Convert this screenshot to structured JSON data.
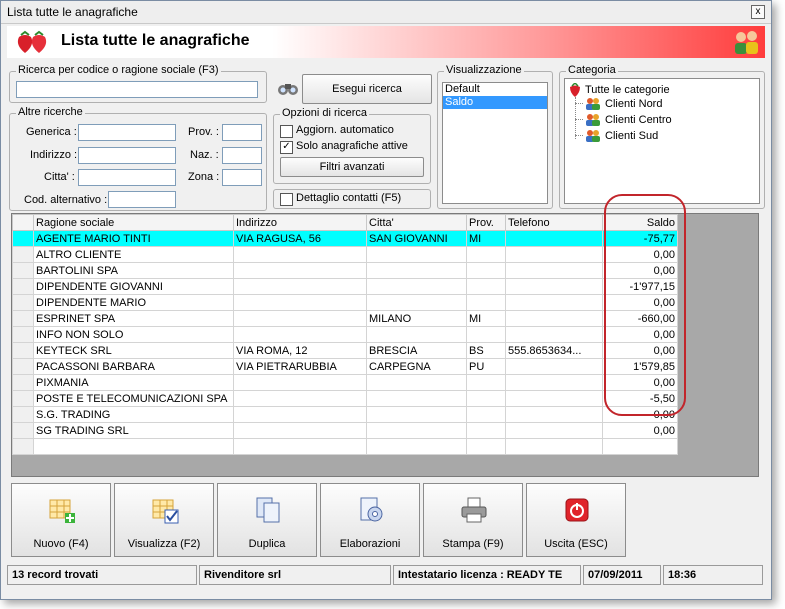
{
  "window": {
    "title": "Lista tutte le anagrafiche",
    "close_label": "x"
  },
  "banner": {
    "title": "Lista tutte le anagrafiche"
  },
  "search": {
    "legend": "Ricerca per codice o ragione sociale (F3)",
    "value": "",
    "run_label": "Esegui ricerca"
  },
  "other": {
    "legend": "Altre ricerche",
    "generica": "Generica :",
    "indirizzo": "Indirizzo :",
    "citta": "Citta' :",
    "cod_alt": "Cod. alternativo :",
    "prov": "Prov. :",
    "naz": "Naz. :",
    "zona": "Zona :"
  },
  "options": {
    "legend": "Opzioni di ricerca",
    "auto_label": "Aggiorn. automatico",
    "auto_checked": false,
    "active_label": "Solo anagrafiche attive",
    "active_checked": true,
    "mark": "✓",
    "advanced_label": "Filtri avanzati"
  },
  "details": {
    "label": "Dettaglio contatti (F5)",
    "checked": false
  },
  "visual": {
    "legend": "Visualizzazione",
    "items": [
      "Default",
      "Saldo"
    ],
    "selected": 1
  },
  "category": {
    "legend": "Categoria",
    "root": "Tutte le categorie",
    "items": [
      "Clienti Nord",
      "Clienti Centro",
      "Clienti Sud"
    ]
  },
  "table": {
    "headers": [
      "Ragione sociale",
      "Indirizzo",
      "Citta'",
      "Prov.",
      "Telefono",
      "Saldo"
    ],
    "rows": [
      [
        "AGENTE MARIO TINTI",
        "VIA RAGUSA, 56",
        "SAN GIOVANNI",
        "MI",
        "",
        "-75,77"
      ],
      [
        "ALTRO CLIENTE",
        "",
        "",
        "",
        "",
        "0,00"
      ],
      [
        "BARTOLINI SPA",
        "",
        "",
        "",
        "",
        "0,00"
      ],
      [
        "DIPENDENTE GIOVANNI",
        "",
        "",
        "",
        "",
        "-1'977,15"
      ],
      [
        "DIPENDENTE MARIO",
        "",
        "",
        "",
        "",
        "0,00"
      ],
      [
        "ESPRINET SPA",
        "",
        "MILANO",
        "MI",
        "",
        "-660,00"
      ],
      [
        "INFO NON SOLO",
        "",
        "",
        "",
        "",
        "0,00"
      ],
      [
        "KEYTECK SRL",
        "VIA ROMA, 12",
        "BRESCIA",
        "BS",
        "555.8653634...",
        "0,00"
      ],
      [
        "PACASSONI BARBARA",
        "VIA PIETRARUBBIA",
        "CARPEGNA",
        "PU",
        "",
        "1'579,85"
      ],
      [
        "PIXMANIA",
        "",
        "",
        "",
        "",
        "0,00"
      ],
      [
        "POSTE E TELECOMUNICAZIONI SPA",
        "",
        "",
        "",
        "",
        "-5,50"
      ],
      [
        "S.G. TRADING",
        "",
        "",
        "",
        "",
        "0,00"
      ],
      [
        "SG TRADING SRL",
        "",
        "",
        "",
        "",
        "0,00"
      ],
      [
        "",
        "",
        "",
        "",
        "",
        ""
      ]
    ],
    "highlight_color": "#00ffff"
  },
  "toolbar": {
    "buttons": [
      {
        "label": "Nuovo (F4)",
        "icon": "new-record-icon"
      },
      {
        "label": "Visualizza (F2)",
        "icon": "view-record-icon"
      },
      {
        "label": "Duplica",
        "icon": "duplicate-icon"
      },
      {
        "label": "Elaborazioni",
        "icon": "processing-icon"
      },
      {
        "label": "Stampa (F9)",
        "icon": "printer-icon"
      },
      {
        "label": "Uscita (ESC)",
        "icon": "exit-icon"
      }
    ]
  },
  "status": {
    "records": "13 record trovati",
    "company": "Rivenditore srl",
    "license": "Intestatario licenza : READY TE",
    "date": "07/09/2011",
    "time": "18:36"
  },
  "colors": {
    "accent_red": "#e0242b",
    "selection_blue": "#3399ff"
  }
}
